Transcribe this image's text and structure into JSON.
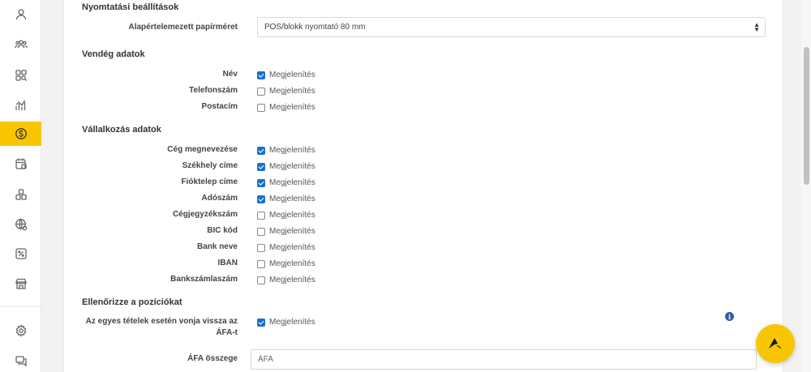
{
  "sidebar": {
    "icons": [
      "user-icon",
      "group-icon",
      "grid-search-icon",
      "chart-icon",
      "dollar-icon",
      "calendar-icon",
      "building-icon",
      "globe-icon",
      "percent-icon",
      "store-icon",
      "settings-icon",
      "chat-icon"
    ],
    "active_index": 4
  },
  "print_settings": {
    "title": "Nyomtatási beállítások",
    "paper_label": "Alapértelemezett papírméret",
    "paper_value": "POS/blokk nyomtató 80 mm"
  },
  "guest": {
    "title": "Vendég adatok",
    "rows": [
      {
        "label": "Név",
        "checked": true
      },
      {
        "label": "Telefonszám",
        "checked": false
      },
      {
        "label": "Postacím",
        "checked": false
      }
    ]
  },
  "business": {
    "title": "Vállalkozás adatok",
    "rows": [
      {
        "label": "Cég megnevezése",
        "checked": true
      },
      {
        "label": "Székhely címe",
        "checked": true
      },
      {
        "label": "Fióktelep címe",
        "checked": true
      },
      {
        "label": "Adószám",
        "checked": true
      },
      {
        "label": "Cégjegyzékszám",
        "checked": false
      },
      {
        "label": "BIC kód",
        "checked": false
      },
      {
        "label": "Bank neve",
        "checked": false
      },
      {
        "label": "IBAN",
        "checked": false
      },
      {
        "label": "Bankszámlaszám",
        "checked": false
      }
    ]
  },
  "positions": {
    "title": "Ellenőrizze a pozíciókat",
    "vat_row_label": "Az egyes tételek esetén vonja vissza az ÁFA-t",
    "vat_row_checked": true,
    "vat_amount_label": "ÁFA összege",
    "vat_amount_value": "ÁFA"
  },
  "checkbox_text": "Megjelenítés",
  "info_glyph": "i"
}
